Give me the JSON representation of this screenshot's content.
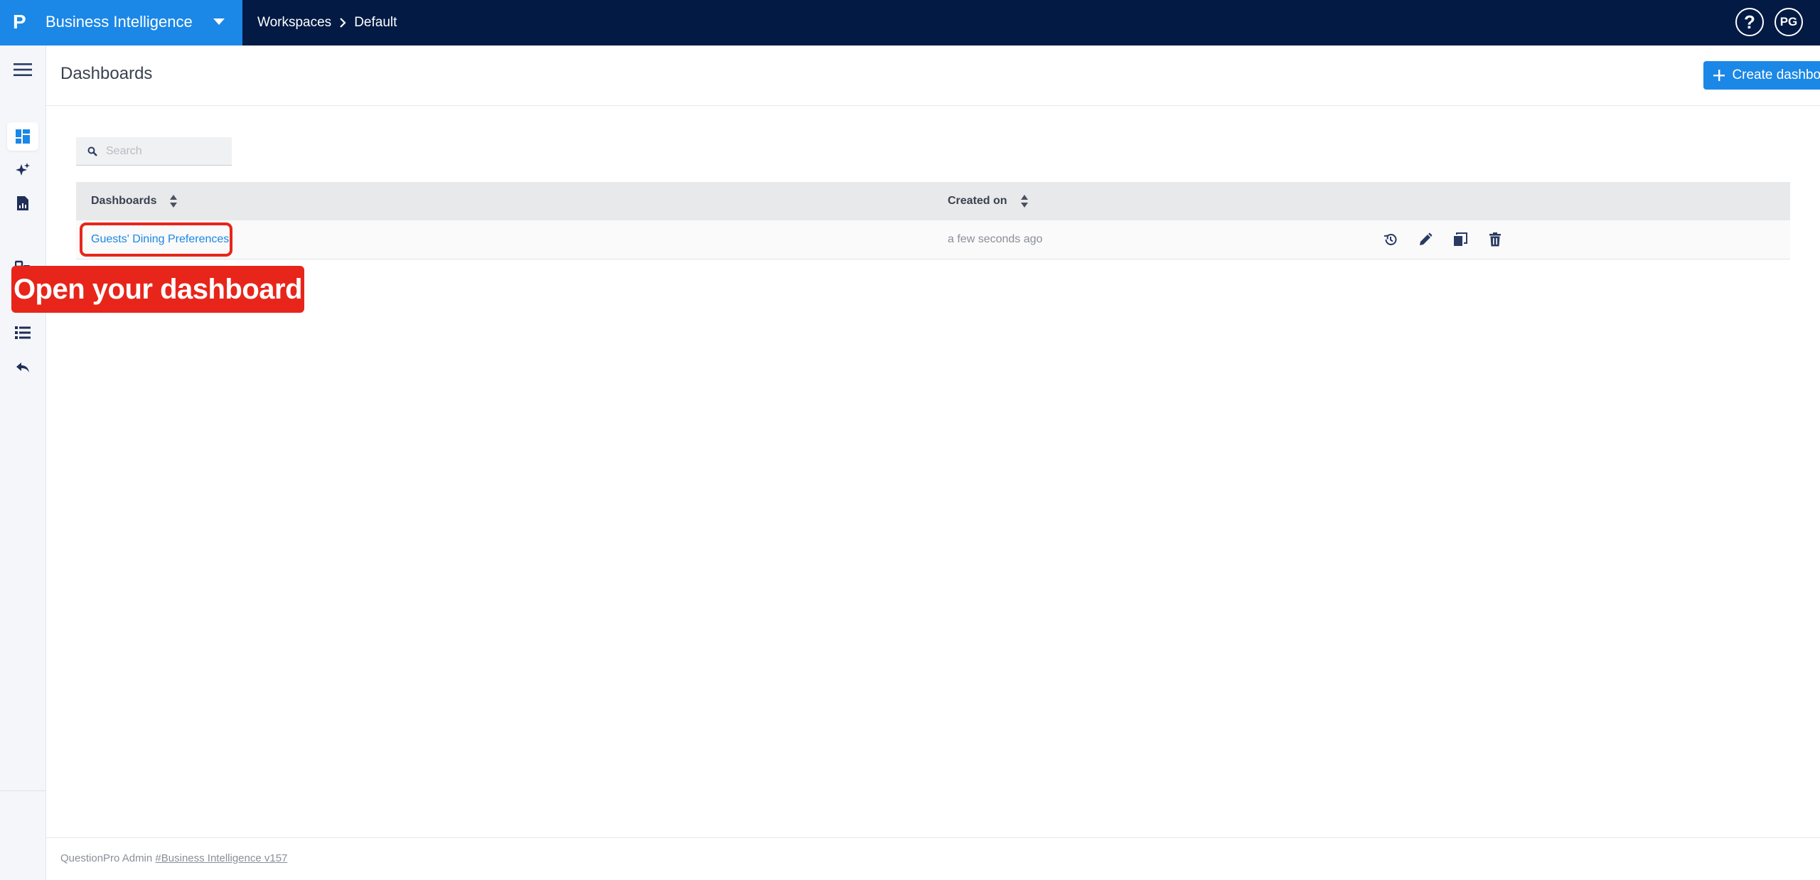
{
  "brand": {
    "title": "Business Intelligence",
    "logo_letter": "P"
  },
  "breadcrumb": {
    "items": [
      "Workspaces",
      "Default"
    ]
  },
  "header_right": {
    "help_label": "?",
    "avatar_initials": "PG"
  },
  "page": {
    "title": "Dashboards",
    "create_button": "Create dashboard"
  },
  "search": {
    "placeholder": "Search",
    "value": ""
  },
  "table": {
    "columns": [
      "Dashboards",
      "Created on"
    ],
    "rows": [
      {
        "name": "Guests' Dining Preferences",
        "created_on": "a few seconds ago"
      }
    ]
  },
  "callout": {
    "text": "Open your dashboard"
  },
  "footer": {
    "prefix": "QuestionPro Admin",
    "link": "#Business Intelligence v157"
  },
  "colors": {
    "accent": "#1b87e6",
    "topbar": "#021a44",
    "highlight": "#e8251a"
  },
  "icons": {
    "sidebar": [
      "dashboard-icon",
      "sparkle-icon",
      "report-icon",
      "datasource-icon",
      "list-icon",
      "back-icon"
    ],
    "row_actions": [
      "history-icon",
      "edit-icon",
      "copy-icon",
      "delete-icon"
    ]
  }
}
